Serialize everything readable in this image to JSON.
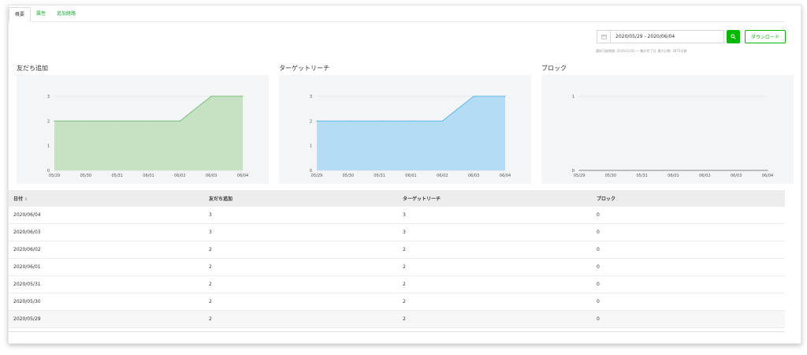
{
  "tabs": [
    {
      "label": "概要",
      "active": true
    },
    {
      "label": "属性",
      "active": false
    },
    {
      "label": "追加経路",
      "active": false
    }
  ],
  "date_range": {
    "value": "2020/05/29 - 2020/06/04",
    "icon": "calendar-icon"
  },
  "search_button": {
    "icon": "search-icon"
  },
  "download_label": "ダウンロード",
  "period_note": "選択可能期間: 2016/11/01 〜 集計完了日, 最大日数: 3972日間",
  "colors": {
    "accent": "#00b900",
    "friends_fill": "#c6e2c3",
    "friends_line": "#7bbf79",
    "target_fill": "#b4ddf5",
    "target_line": "#5fb6e6",
    "block_line": "#888888"
  },
  "chart_data": [
    {
      "type": "area",
      "title": "友だち追加",
      "x": [
        "05/29",
        "05/30",
        "05/31",
        "06/01",
        "06/02",
        "06/03",
        "06/04"
      ],
      "series": [
        {
          "values": [
            2,
            2,
            2,
            2,
            2,
            3,
            3
          ]
        }
      ],
      "ylim": [
        0,
        3
      ],
      "yticks": [
        "0",
        "1",
        "2",
        "3"
      ],
      "grid": true
    },
    {
      "type": "area",
      "title": "ターゲットリーチ",
      "x": [
        "05/29",
        "05/30",
        "05/31",
        "06/01",
        "06/02",
        "06/03",
        "06/04"
      ],
      "series": [
        {
          "values": [
            2,
            2,
            2,
            2,
            2,
            3,
            3
          ]
        }
      ],
      "ylim": [
        0,
        3
      ],
      "yticks": [
        "0",
        "1",
        "2",
        "3"
      ],
      "grid": true
    },
    {
      "type": "line",
      "title": "ブロック",
      "x": [
        "05/29",
        "05/30",
        "05/31",
        "06/01",
        "06/02",
        "06/03",
        "06/04"
      ],
      "series": [
        {
          "values": [
            0,
            0,
            0,
            0,
            0,
            0,
            0
          ]
        }
      ],
      "ylim": [
        0,
        1
      ],
      "yticks": [
        "0",
        "1"
      ],
      "grid": true
    }
  ],
  "table": {
    "headers": [
      "日付",
      "友だち追加",
      "ターゲットリーチ",
      "ブロック"
    ],
    "sort_icon": "⇕",
    "rows": [
      [
        "2020/06/04",
        "3",
        "3",
        "0"
      ],
      [
        "2020/06/03",
        "3",
        "3",
        "0"
      ],
      [
        "2020/06/02",
        "2",
        "2",
        "0"
      ],
      [
        "2020/06/01",
        "2",
        "2",
        "0"
      ],
      [
        "2020/05/31",
        "2",
        "2",
        "0"
      ],
      [
        "2020/05/30",
        "2",
        "2",
        "0"
      ],
      [
        "2020/05/29",
        "2",
        "2",
        "0"
      ]
    ]
  }
}
